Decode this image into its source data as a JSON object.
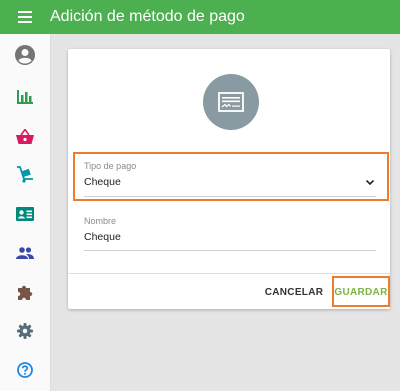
{
  "app": {
    "title": "Adición de método de pago"
  },
  "sidebar": {
    "items": [
      {
        "icon": "account-circle-icon"
      },
      {
        "icon": "bar-chart-icon"
      },
      {
        "icon": "shopping-basket-icon"
      },
      {
        "icon": "dolly-icon"
      },
      {
        "icon": "contact-card-icon"
      },
      {
        "icon": "people-icon"
      },
      {
        "icon": "puzzle-icon"
      },
      {
        "icon": "settings-icon"
      },
      {
        "icon": "help-icon"
      }
    ]
  },
  "form": {
    "payment_type": {
      "label": "Tipo de pago",
      "value": "Cheque"
    },
    "name": {
      "label": "Nombre",
      "value": "Cheque"
    },
    "cancel_label": "CANCELAR",
    "save_label": "GUARDAR"
  },
  "colors": {
    "topbar": "#4caf50",
    "highlight": "#ef7c2a",
    "save": "#7cb342",
    "avatar": "#8a9aa3"
  }
}
